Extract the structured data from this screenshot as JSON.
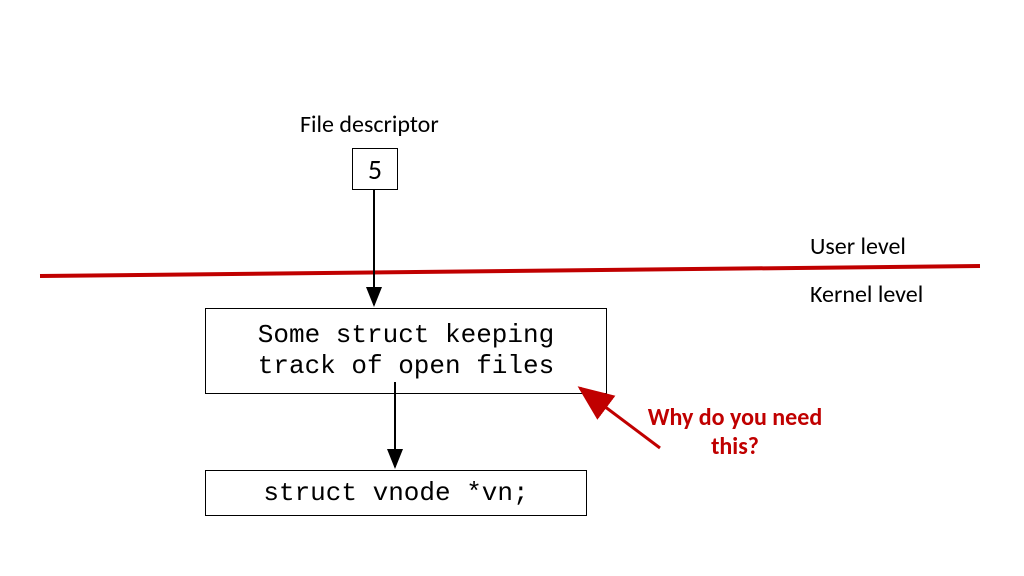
{
  "title": "File descriptor",
  "fd_value": "5",
  "levels": {
    "user": "User level",
    "kernel": "Kernel level"
  },
  "mid_box": "Some struct keeping\ntrack of open files",
  "bottom_box": "struct vnode *vn;",
  "annotation": "Why do you need\nthis?"
}
